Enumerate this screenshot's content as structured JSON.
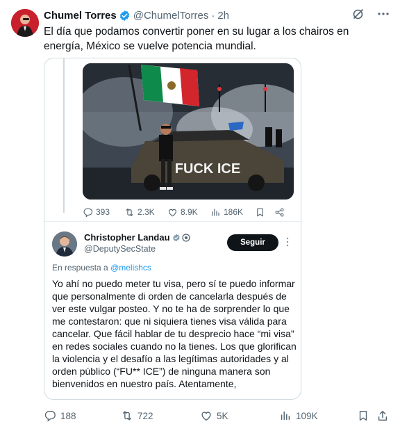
{
  "author": {
    "name": "Chumel Torres",
    "handle": "@ChumelTorres",
    "separator": "·",
    "time": "2h"
  },
  "tweet_text": "El día que podamos convertir poner en su lugar a los chairos en energía, México se vuelve potencia mundial.",
  "quoted": {
    "photo_overlay_text": "FUCK ICE",
    "inner_stats": {
      "replies": "393",
      "reposts": "2.3K",
      "likes": "8.9K",
      "views": "186K"
    },
    "author_name": "Christopher Landau",
    "author_handle": "@DeputySecState",
    "follow_label": "Seguir",
    "reply_prefix": "En respuesta a",
    "reply_mention": "@melishcs",
    "text": "Yo ahí no puedo meter tu visa, pero sí te puedo informar que personalmente di orden de cancelarla después de ver este vulgar posteo. Y no te ha de sorprender lo que me contestaron: que ni siquiera tienes visa válida para cancelar. Que fácil hablar de tu desprecio hace “mi visa” en redes sociales cuando no la tienes. Los que glorifican la violencia y el desafío a las legítimas autoridades y al orden público (“FU** ICE”) de ninguna manera son bienvenidos en nuestro país. Atentamente,"
  },
  "stats": {
    "replies": "188",
    "reposts": "722",
    "likes": "5K",
    "views": "109K"
  },
  "icons": [
    "grok-icon",
    "more-icon",
    "reply-icon",
    "repost-icon",
    "like-icon",
    "views-icon",
    "bookmark-icon",
    "share-icon"
  ],
  "colors": {
    "accent": "#1d9bf0",
    "text": "#0f1419",
    "secondary": "#536471",
    "border": "#cfd9de"
  }
}
